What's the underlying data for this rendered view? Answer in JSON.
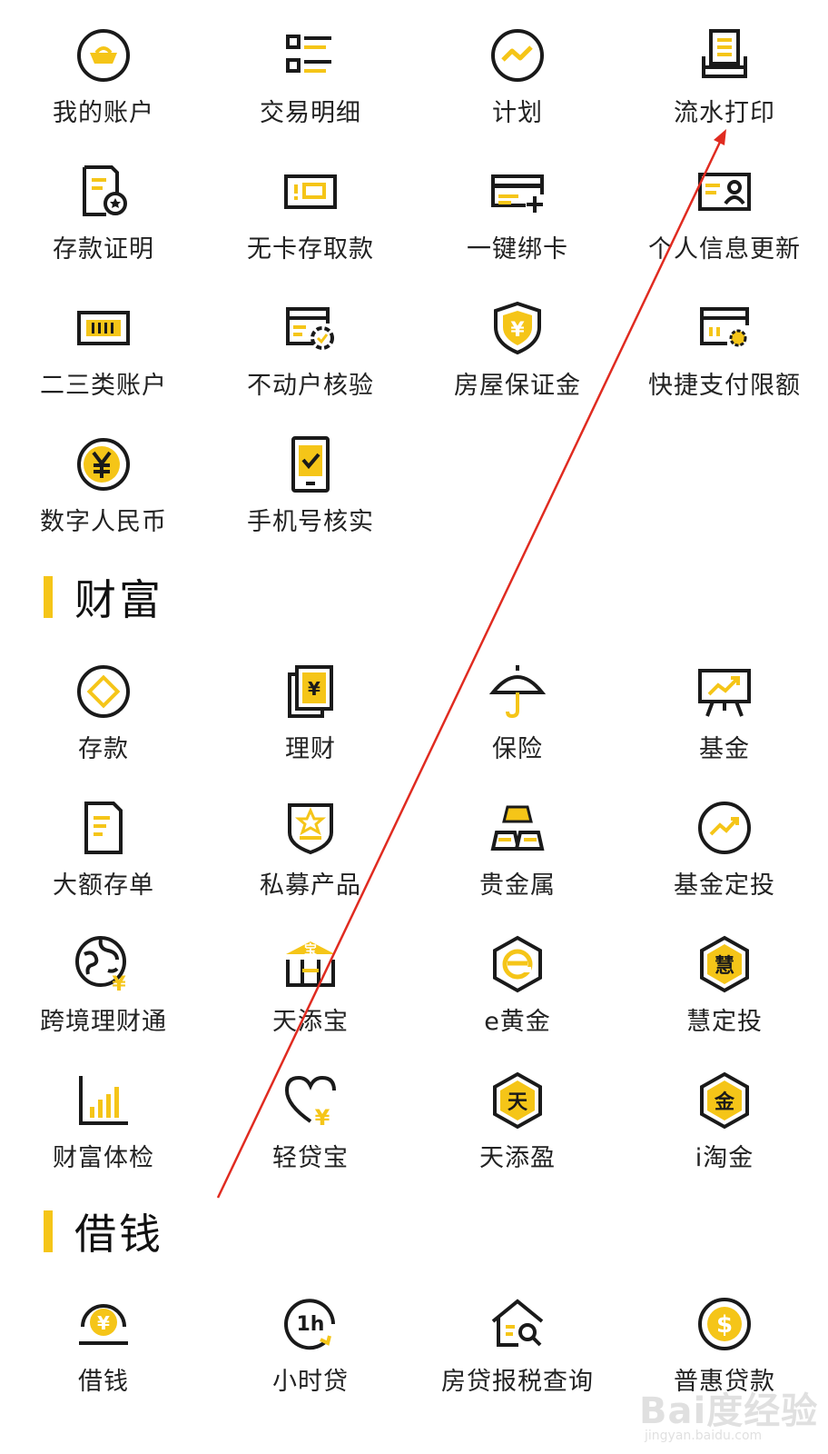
{
  "colors": {
    "accent": "#F5C518",
    "icon_stroke": "#1a1a1a",
    "annotation": "#E02B20"
  },
  "top_items": [
    {
      "label": "我的账户",
      "icon": "gold-ingot-icon"
    },
    {
      "label": "交易明细",
      "icon": "list-detail-icon"
    },
    {
      "label": "计划",
      "icon": "trend-circle-icon"
    },
    {
      "label": "流水打印",
      "icon": "printer-icon"
    },
    {
      "label": "存款证明",
      "icon": "certificate-icon"
    },
    {
      "label": "无卡存取款",
      "icon": "cardless-icon"
    },
    {
      "label": "一键绑卡",
      "icon": "bind-card-icon"
    },
    {
      "label": "个人信息更新",
      "icon": "id-card-icon"
    },
    {
      "label": "二三类账户",
      "icon": "account-card-icon"
    },
    {
      "label": "不动户核验",
      "icon": "verify-gear-icon"
    },
    {
      "label": "房屋保证金",
      "icon": "yuan-shield-icon"
    },
    {
      "label": "快捷支付限额",
      "icon": "payment-limit-icon"
    },
    {
      "label": "数字人民币",
      "icon": "digital-yuan-icon"
    },
    {
      "label": "手机号核实",
      "icon": "phone-check-icon"
    }
  ],
  "sections": [
    {
      "title": "财富",
      "items": [
        {
          "label": "存款",
          "icon": "deposit-icon"
        },
        {
          "label": "理财",
          "icon": "wealth-book-icon"
        },
        {
          "label": "保险",
          "icon": "umbrella-icon"
        },
        {
          "label": "基金",
          "icon": "fund-board-icon"
        },
        {
          "label": "大额存单",
          "icon": "document-icon"
        },
        {
          "label": "私募产品",
          "icon": "private-badge-icon"
        },
        {
          "label": "贵金属",
          "icon": "gold-bars-icon"
        },
        {
          "label": "基金定投",
          "icon": "fund-trend-icon"
        },
        {
          "label": "跨境理财通",
          "icon": "globe-yuan-icon"
        },
        {
          "label": "天添宝",
          "icon": "bao-box-icon"
        },
        {
          "label": "e黄金",
          "icon": "e-gold-icon"
        },
        {
          "label": "慧定投",
          "icon": "hui-hexagon-icon"
        },
        {
          "label": "财富体检",
          "icon": "bar-chart-icon"
        },
        {
          "label": "轻贷宝",
          "icon": "heart-yuan-icon"
        },
        {
          "label": "天添盈",
          "icon": "tian-hexagon-icon"
        },
        {
          "label": "i淘金",
          "icon": "jin-hexagon-icon"
        }
      ]
    },
    {
      "title": "借钱",
      "items": [
        {
          "label": "借钱",
          "icon": "loan-coin-icon"
        },
        {
          "label": "小时贷",
          "icon": "hour-loan-icon"
        },
        {
          "label": "房贷报税查询",
          "icon": "house-search-icon"
        },
        {
          "label": "普惠贷款",
          "icon": "dollar-coin-icon"
        }
      ]
    }
  ],
  "watermark": {
    "text": "Bai度经验",
    "url": "jingyan.baidu.com"
  }
}
